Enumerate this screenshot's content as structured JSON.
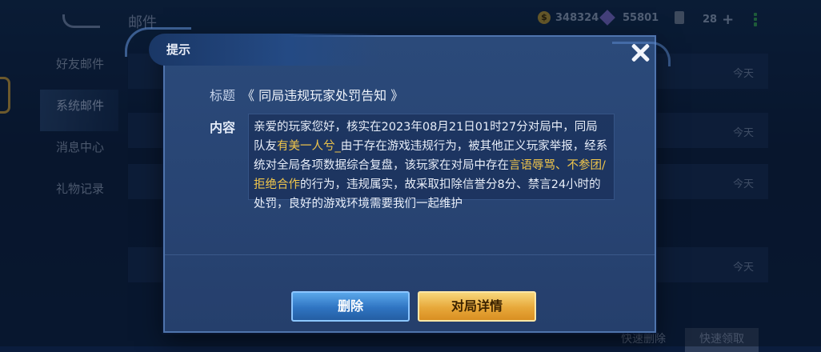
{
  "background": {
    "page_title": "邮件",
    "currencies": [
      {
        "icon": "gold-coin-icon",
        "value": "348324"
      },
      {
        "icon": "diamond-icon",
        "value": "55801"
      },
      {
        "icon": "ticket-icon",
        "value": "28"
      }
    ],
    "nav_items": [
      {
        "label": "好友邮件"
      },
      {
        "label": "系统邮件"
      },
      {
        "label": "消息中心"
      },
      {
        "label": "礼物记录"
      }
    ],
    "mail_rows": [
      {
        "day": "今天"
      },
      {
        "day": "今天"
      },
      {
        "day": "今天"
      },
      {
        "day": "今天"
      }
    ],
    "quick_delete": "快速删除",
    "quick_claim": "快速领取"
  },
  "dialog": {
    "title": "提示",
    "subject_label": "标题",
    "subject": "《 同局违规玩家处罚告知 》",
    "content_label": "内容",
    "content_parts": [
      "亲爱的玩家您好，核实在2023年08月21日01时27分对局中，同局队友",
      "有美一人兮_",
      "由于存在游戏违规行为，被其他正义玩家举报，经系统对全局各项数据综合复盘，该玩家在对局中存在",
      "言语辱骂、不参团/拒绝合作",
      "的行为，违规属实，故采取扣除信誉分8分、禁言24小时的处罚，良好的游戏环境需要我们一起维护"
    ],
    "buttons": {
      "delete": "删除",
      "match_detail": "对局详情"
    }
  },
  "colors": {
    "highlight": "#f1c64b",
    "dialog_bg": "#2b4a7a",
    "delete_btn": "#3b86d6",
    "detail_btn": "#e7a83a"
  }
}
